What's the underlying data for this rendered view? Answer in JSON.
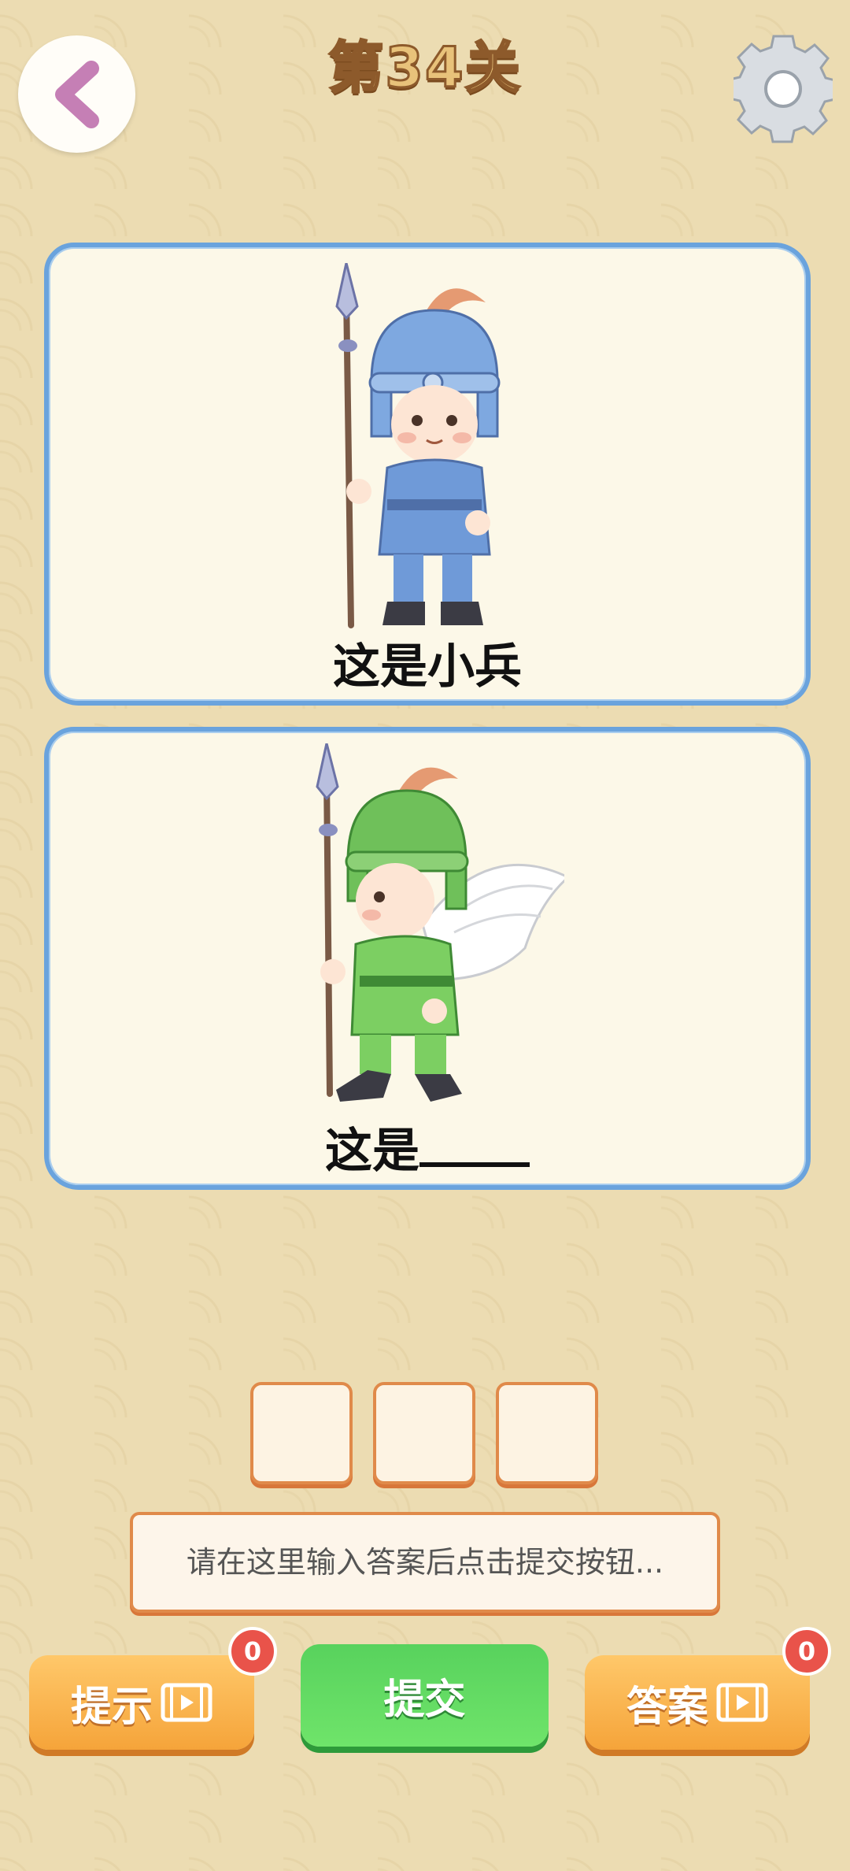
{
  "header": {
    "title": "第34关"
  },
  "cards": [
    {
      "caption": "这是小兵"
    },
    {
      "caption_prefix": "这是"
    }
  ],
  "input": {
    "placeholder": "请在这里输入答案后点击提交按钮..."
  },
  "buttons": {
    "hint_label": "提示",
    "hint_count": "0",
    "submit_label": "提交",
    "answer_label": "答案",
    "answer_count": "0"
  },
  "colors": {
    "card_border": "#6aa3dd",
    "orange_button": "#f5a43a",
    "green_button": "#58d25d",
    "badge": "#e9534a",
    "back_arrow": "#c57fb5"
  }
}
